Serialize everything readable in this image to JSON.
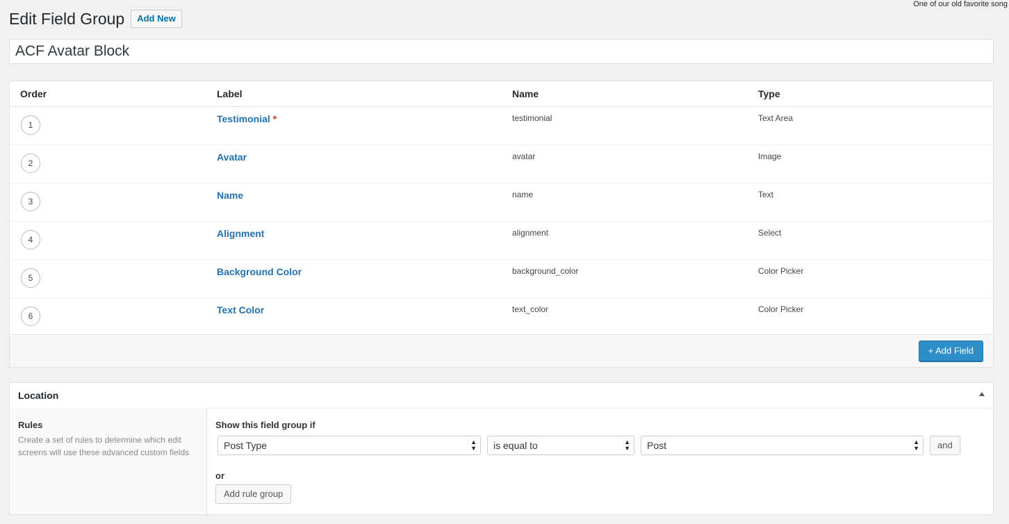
{
  "top_note": "One of our old favorite song",
  "header": {
    "title": "Edit Field Group",
    "add_new_label": "Add New"
  },
  "group_title": {
    "value": "ACF Avatar Block"
  },
  "fields_table": {
    "columns": {
      "order": "Order",
      "label": "Label",
      "name": "Name",
      "type": "Type"
    },
    "rows": [
      {
        "order": "1",
        "label": "Testimonial",
        "required_mark": "*",
        "name": "testimonial",
        "type": "Text Area"
      },
      {
        "order": "2",
        "label": "Avatar",
        "name": "avatar",
        "type": "Image"
      },
      {
        "order": "3",
        "label": "Name",
        "name": "name",
        "type": "Text"
      },
      {
        "order": "4",
        "label": "Alignment",
        "name": "alignment",
        "type": "Select"
      },
      {
        "order": "5",
        "label": "Background Color",
        "name": "background_color",
        "type": "Color Picker"
      },
      {
        "order": "6",
        "label": "Text Color",
        "name": "text_color",
        "type": "Color Picker"
      }
    ],
    "add_field_label": "+ Add Field"
  },
  "location": {
    "title": "Location",
    "rules_label": "Rules",
    "rules_description": "Create a set of rules to determine which edit screens will use these advanced custom fields",
    "show_if_label": "Show this field group if",
    "param_select": "Post Type",
    "operator_select": "is equal to",
    "value_select": "Post",
    "and_label": "and",
    "or_label": "or",
    "add_rule_group_label": "Add rule group"
  },
  "colors": {
    "link": "#2271b1",
    "primary_button": "#2e8ec9",
    "required": "#dc3232",
    "background": "#f1f1f1"
  }
}
